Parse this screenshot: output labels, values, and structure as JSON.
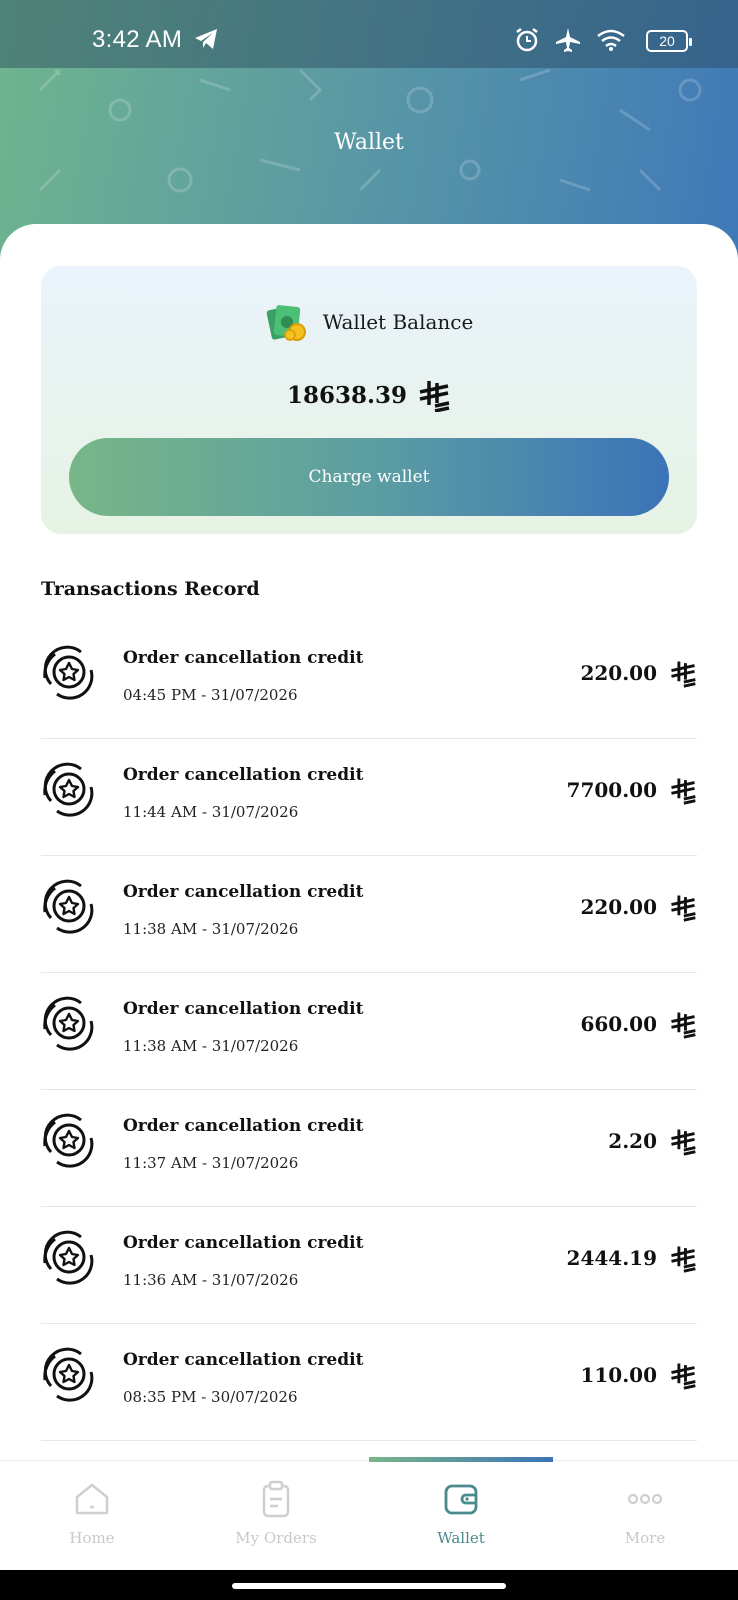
{
  "status_bar": {
    "time": "3:42 AM",
    "battery": "20"
  },
  "header": {
    "title": "Wallet"
  },
  "wallet": {
    "balance_label": "Wallet Balance",
    "balance_amount": "18638.39",
    "charge_label": "Charge wallet"
  },
  "transactions": {
    "title": "Transactions Record",
    "items": [
      {
        "title": "Order cancellation credit",
        "date": "04:45 PM - 31/07/2026",
        "amount": "220.00"
      },
      {
        "title": "Order cancellation credit",
        "date": "11:44 AM - 31/07/2026",
        "amount": "7700.00"
      },
      {
        "title": "Order cancellation credit",
        "date": "11:38 AM - 31/07/2026",
        "amount": "220.00"
      },
      {
        "title": "Order cancellation credit",
        "date": "11:38 AM - 31/07/2026",
        "amount": "660.00"
      },
      {
        "title": "Order cancellation credit",
        "date": "11:37 AM - 31/07/2026",
        "amount": "2.20"
      },
      {
        "title": "Order cancellation credit",
        "date": "11:36 AM - 31/07/2026",
        "amount": "2444.19"
      },
      {
        "title": "Order cancellation credit",
        "date": "08:35 PM - 30/07/2026",
        "amount": "110.00"
      }
    ]
  },
  "nav": {
    "items": [
      {
        "label": "Home",
        "icon": "home-icon"
      },
      {
        "label": "My Orders",
        "icon": "clipboard-icon"
      },
      {
        "label": "Wallet",
        "icon": "wallet-icon",
        "active": true
      },
      {
        "label": "More",
        "icon": "more-dots-icon"
      }
    ]
  },
  "colors": {
    "accent_green": "#78b687",
    "accent_blue": "#3c73b8",
    "active_nav": "#4a8a8d"
  },
  "icons": {
    "currency": "riyal-icon",
    "transaction": "star-refund-icon",
    "balance": "money-stack-icon"
  }
}
